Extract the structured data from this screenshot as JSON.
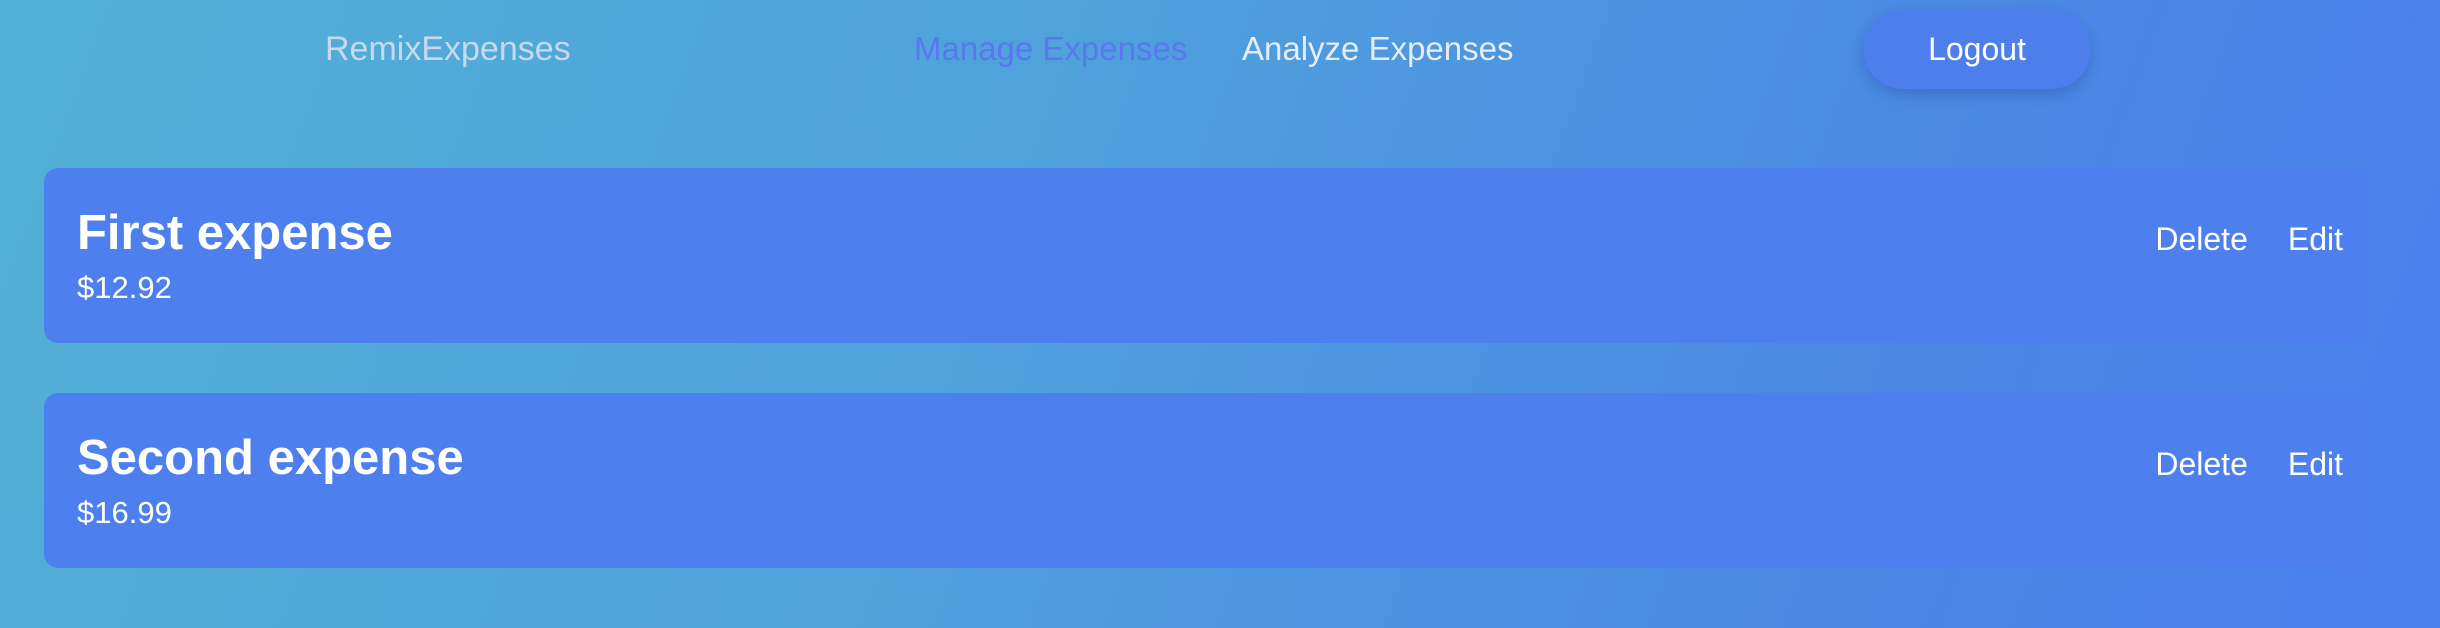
{
  "header": {
    "logo": "RemixExpenses",
    "nav": {
      "manage": "Manage Expenses",
      "analyze": "Analyze Expenses"
    },
    "logout": "Logout"
  },
  "expenses": [
    {
      "title": "First expense",
      "amount": "$12.92",
      "delete": "Delete",
      "edit": "Edit"
    },
    {
      "title": "Second expense",
      "amount": "$16.99",
      "delete": "Delete",
      "edit": "Edit"
    }
  ],
  "colors": {
    "background_start": "#52b0d6",
    "background_end": "#4b7fee",
    "card": "#4d80ee",
    "active_nav": "#5a78ee",
    "logout_button": "#4d7fec"
  }
}
